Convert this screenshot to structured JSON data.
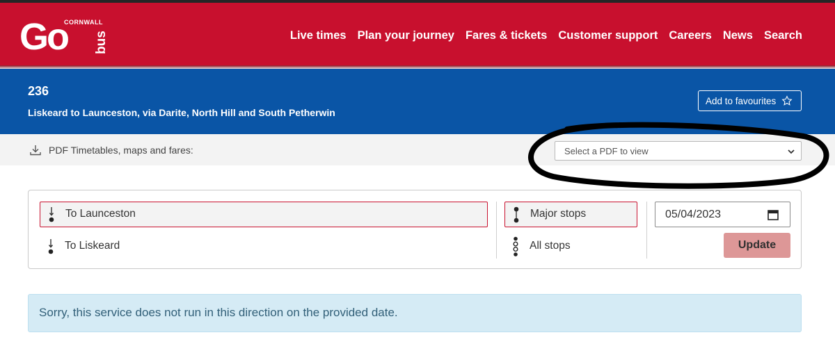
{
  "brand": {
    "logo_main": "Go",
    "logo_top": "CORNWALL",
    "logo_side": "bus"
  },
  "nav": {
    "items": [
      "Live times",
      "Plan your journey",
      "Fares & tickets",
      "Customer support",
      "Careers",
      "News",
      "Search"
    ]
  },
  "route": {
    "number": "236",
    "description": "Liskeard to Launceston, via Darite, North Hill and South Petherwin",
    "favourite_label": "Add to favourites"
  },
  "pdf": {
    "label": "PDF Timetables, maps and fares:",
    "select_value": "Select a PDF to view"
  },
  "filters": {
    "directions": [
      "To Launceston",
      "To Liskeard"
    ],
    "selected_direction": "To Launceston",
    "stops": [
      "Major stops",
      "All stops"
    ],
    "selected_stops": "Major stops",
    "date_value": "05/04/2023",
    "update_label": "Update"
  },
  "alert": {
    "message": "Sorry, this service does not run in this direction on the provided date."
  },
  "colors": {
    "brand_red": "#c8102e",
    "banner_blue": "#0a55a6",
    "alert_bg": "#d5ebf5",
    "update_bg": "#dd9797"
  },
  "icons": {
    "favourite": "star-icon",
    "pdf": "download-icon",
    "direction": "direction-arrow-icon",
    "stops": "stops-dots-icon",
    "calendar": "calendar-icon",
    "select": "chevron-down-icon"
  }
}
